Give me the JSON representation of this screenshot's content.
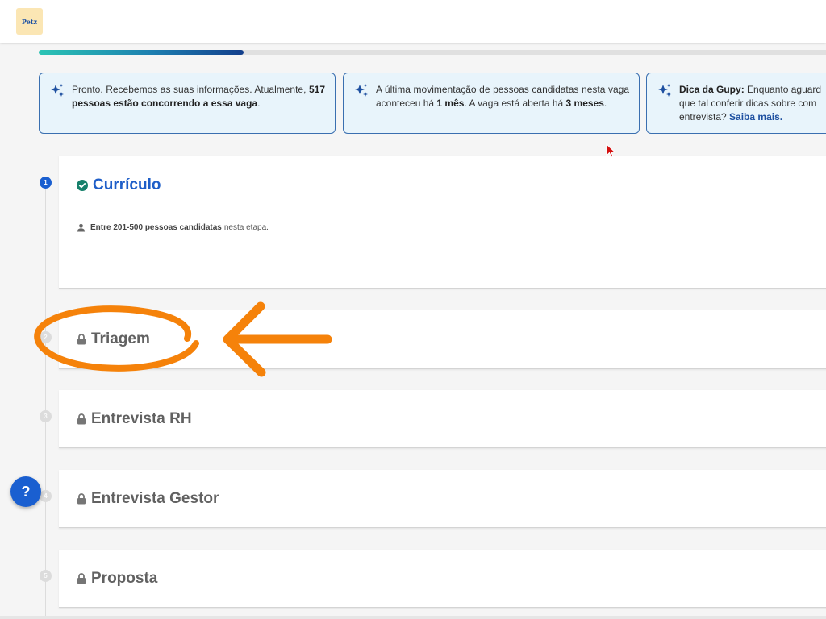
{
  "header": {
    "logo_text": "Petz"
  },
  "progress": {
    "fraction": 0.26
  },
  "info_cards": [
    {
      "text1": "Pronto. Recebemos as suas informações. Atualmente, ",
      "bold1": "517 pessoas estão concorrendo a essa vaga",
      "text2": "."
    },
    {
      "text1": "A última movimentação de pessoas candidatas nesta vaga aconteceu há ",
      "bold1": "1 mês",
      "text2": ". A vaga está aberta há ",
      "bold2": "3 meses",
      "text3": "."
    },
    {
      "bold1": "Dica da Gupy:",
      "text1": " Enquanto aguard",
      "text2": "que tal conferir dicas sobre com",
      "text3": "entrevista? ",
      "link": "Saiba mais."
    }
  ],
  "stages": [
    {
      "number": "1",
      "title": "Currículo",
      "status": "completed",
      "candidates_bold": "Entre 201-500 pessoas candidatas",
      "candidates_suffix": "nesta etapa."
    },
    {
      "number": "2",
      "title": "Triagem",
      "status": "locked"
    },
    {
      "number": "3",
      "title": "Entrevista RH",
      "status": "locked"
    },
    {
      "number": "4",
      "title": "Entrevista Gestor",
      "status": "locked"
    },
    {
      "number": "5",
      "title": "Proposta",
      "status": "locked"
    }
  ],
  "help_button": {
    "label": "?"
  },
  "colors": {
    "accent": "#1a5fd0",
    "completed_check": "#17806b",
    "annotation_orange": "#f5820a",
    "info_card_bg": "#e8f4fb",
    "info_card_border": "#3a6fb0"
  }
}
